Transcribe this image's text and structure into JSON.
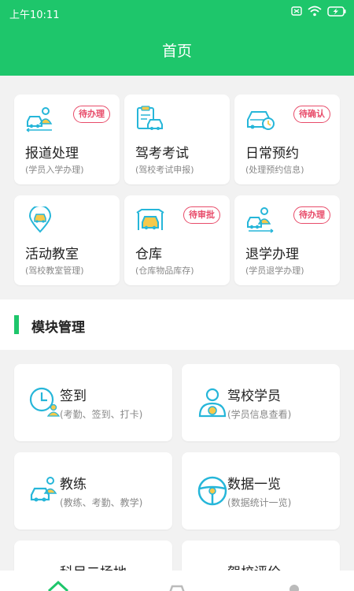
{
  "status_bar": {
    "time": "上午10:11"
  },
  "header": {
    "title": "首页"
  },
  "cards": [
    {
      "title": "报道处理",
      "sub": "(学员入学办理)",
      "badge": "待办理",
      "icon": "student-car-icon"
    },
    {
      "title": "驾考考试",
      "sub": "(驾校考试申报)",
      "badge": "",
      "icon": "clipboard-car-icon"
    },
    {
      "title": "日常预约",
      "sub": "(处理预约信息)",
      "badge": "待确认",
      "icon": "car-clock-icon"
    },
    {
      "title": "活动教室",
      "sub": "(驾校教室管理)",
      "badge": "",
      "icon": "location-car-icon"
    },
    {
      "title": "仓库",
      "sub": "(仓库物品库存)",
      "badge": "待审批",
      "icon": "garage-car-icon"
    },
    {
      "title": "退学办理",
      "sub": "(学员退学办理)",
      "badge": "待办理",
      "icon": "student-exit-icon"
    }
  ],
  "section": {
    "title": "模块管理"
  },
  "modules": [
    {
      "title": "签到",
      "sub": "(考勤、签到、打卡)",
      "icon": "clock-user-icon"
    },
    {
      "title": "驾校学员",
      "sub": "(学员信息查看)",
      "icon": "driver-icon"
    },
    {
      "title": "教练",
      "sub": "(教练、考勤、教学)",
      "icon": "coach-car-icon"
    },
    {
      "title": "数据一览",
      "sub": "(数据统计一览)",
      "icon": "steering-wheel-icon"
    },
    {
      "title": "科目二场地",
      "sub": "",
      "icon": "field-icon"
    },
    {
      "title": "驾校评价",
      "sub": "",
      "icon": "rating-icon"
    }
  ],
  "colors": {
    "brand": "#1ec66b",
    "accent_icon": "#26b6d9",
    "badge": "#e84c6a"
  }
}
